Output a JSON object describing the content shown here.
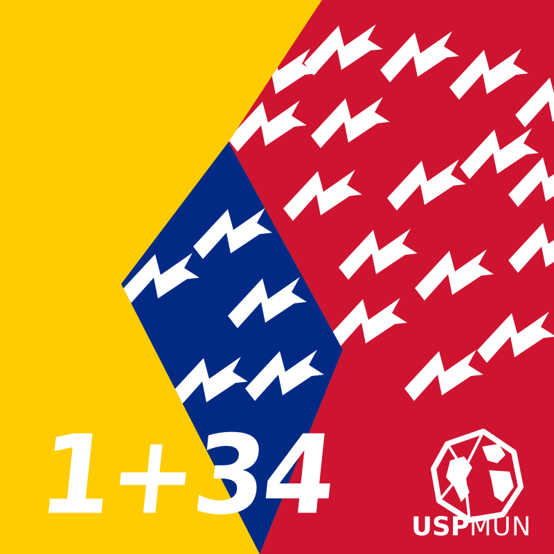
{
  "poster": {
    "headline": "1+34",
    "brand": {
      "part1": "USP",
      "part2": "MUN"
    }
  },
  "colors": {
    "yellow": "#FFCC00",
    "red": "#CE1430",
    "blue": "#022A84",
    "white": "#FFFFFF"
  },
  "icons": {
    "motif": "chevron-m-shape",
    "logo": "globe-icon"
  }
}
